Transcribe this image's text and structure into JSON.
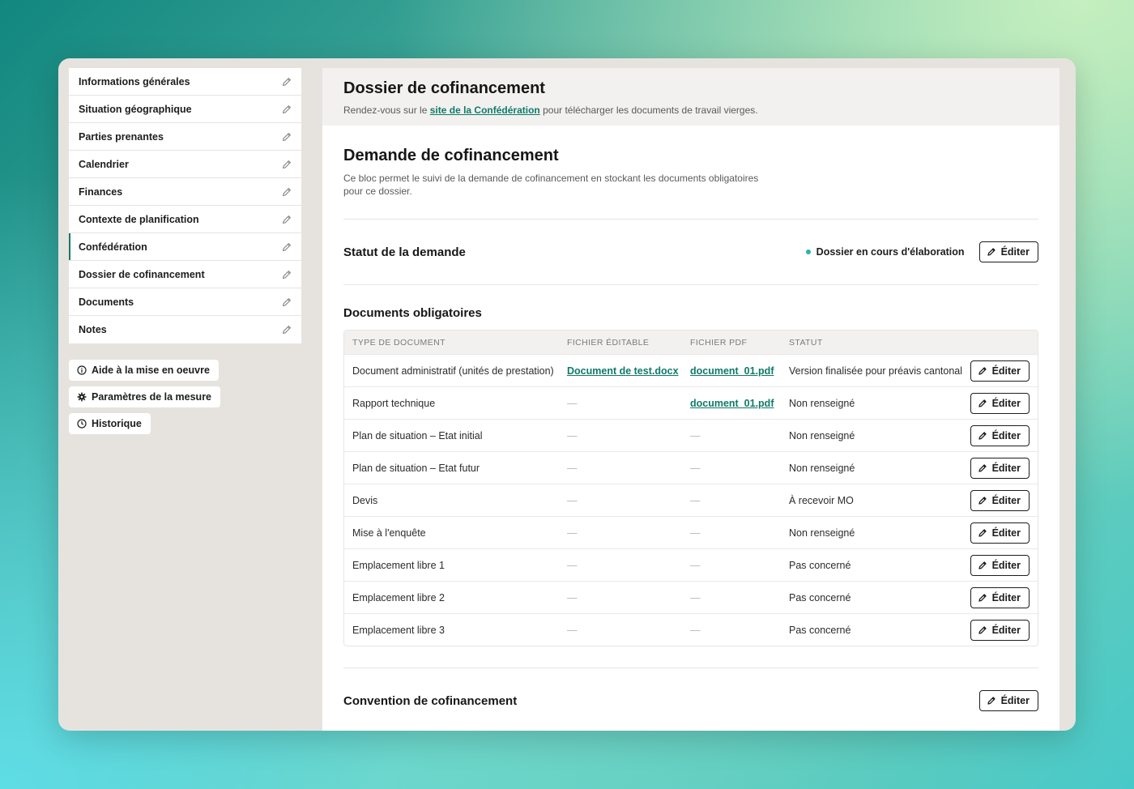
{
  "sidebar": {
    "items": [
      {
        "label": "Informations générales",
        "active": false
      },
      {
        "label": "Situation géographique",
        "active": false
      },
      {
        "label": "Parties prenantes",
        "active": false
      },
      {
        "label": "Calendrier",
        "active": false
      },
      {
        "label": "Finances",
        "active": false
      },
      {
        "label": "Contexte de planification",
        "active": false
      },
      {
        "label": "Confédération",
        "active": true
      },
      {
        "label": "Dossier de cofinancement",
        "active": false
      },
      {
        "label": "Documents",
        "active": false
      },
      {
        "label": "Notes",
        "active": false
      }
    ],
    "actions": [
      {
        "label": "Aide à la mise en oeuvre",
        "icon": "info-icon"
      },
      {
        "label": "Paramètres de la mesure",
        "icon": "gear-icon"
      },
      {
        "label": "Historique",
        "icon": "clock-icon"
      }
    ]
  },
  "header": {
    "title": "Dossier de cofinancement",
    "sub_prefix": "Rendez-vous sur le",
    "sub_link": "site de la Confédération",
    "sub_suffix": "pour télécharger les documents de travail vierges."
  },
  "section": {
    "title": "Demande de cofinancement",
    "description": "Ce bloc permet le suivi de la demande de cofinancement en stockant les documents obligatoires pour ce dossier."
  },
  "status": {
    "label": "Statut de la demande",
    "value": "Dossier en cours d'élaboration",
    "edit_label": "Éditer",
    "dot_color": "#2ab3b0"
  },
  "documents": {
    "title": "Documents obligatoires",
    "columns": [
      "Type de document",
      "Fichier éditable",
      "Fichier PDF",
      "Statut"
    ],
    "edit_label": "Éditer",
    "rows": [
      {
        "type": "Document administratif (unités de prestation)",
        "editable": "Document de test.docx",
        "pdf": "document_01.pdf",
        "status": "Version finalisée pour préavis cantonal"
      },
      {
        "type": "Rapport technique",
        "editable": "—",
        "pdf": "document_01.pdf",
        "status": "Non renseigné"
      },
      {
        "type": "Plan de situation – Etat initial",
        "editable": "—",
        "pdf": "—",
        "status": "Non renseigné"
      },
      {
        "type": "Plan de situation – Etat futur",
        "editable": "—",
        "pdf": "—",
        "status": "Non renseigné"
      },
      {
        "type": "Devis",
        "editable": "—",
        "pdf": "—",
        "status": "À recevoir MO"
      },
      {
        "type": "Mise à l'enquête",
        "editable": "—",
        "pdf": "—",
        "status": "Non renseigné"
      },
      {
        "type": "Emplacement libre 1",
        "editable": "—",
        "pdf": "—",
        "status": "Pas concerné"
      },
      {
        "type": "Emplacement libre 2",
        "editable": "—",
        "pdf": "—",
        "status": "Pas concerné"
      },
      {
        "type": "Emplacement libre 3",
        "editable": "—",
        "pdf": "—",
        "status": "Pas concerné"
      }
    ]
  },
  "convention": {
    "label": "Convention de cofinancement",
    "edit_label": "Éditer"
  },
  "colors": {
    "accent": "#0f7a6a",
    "sidebar_bg": "#e6e3df"
  }
}
